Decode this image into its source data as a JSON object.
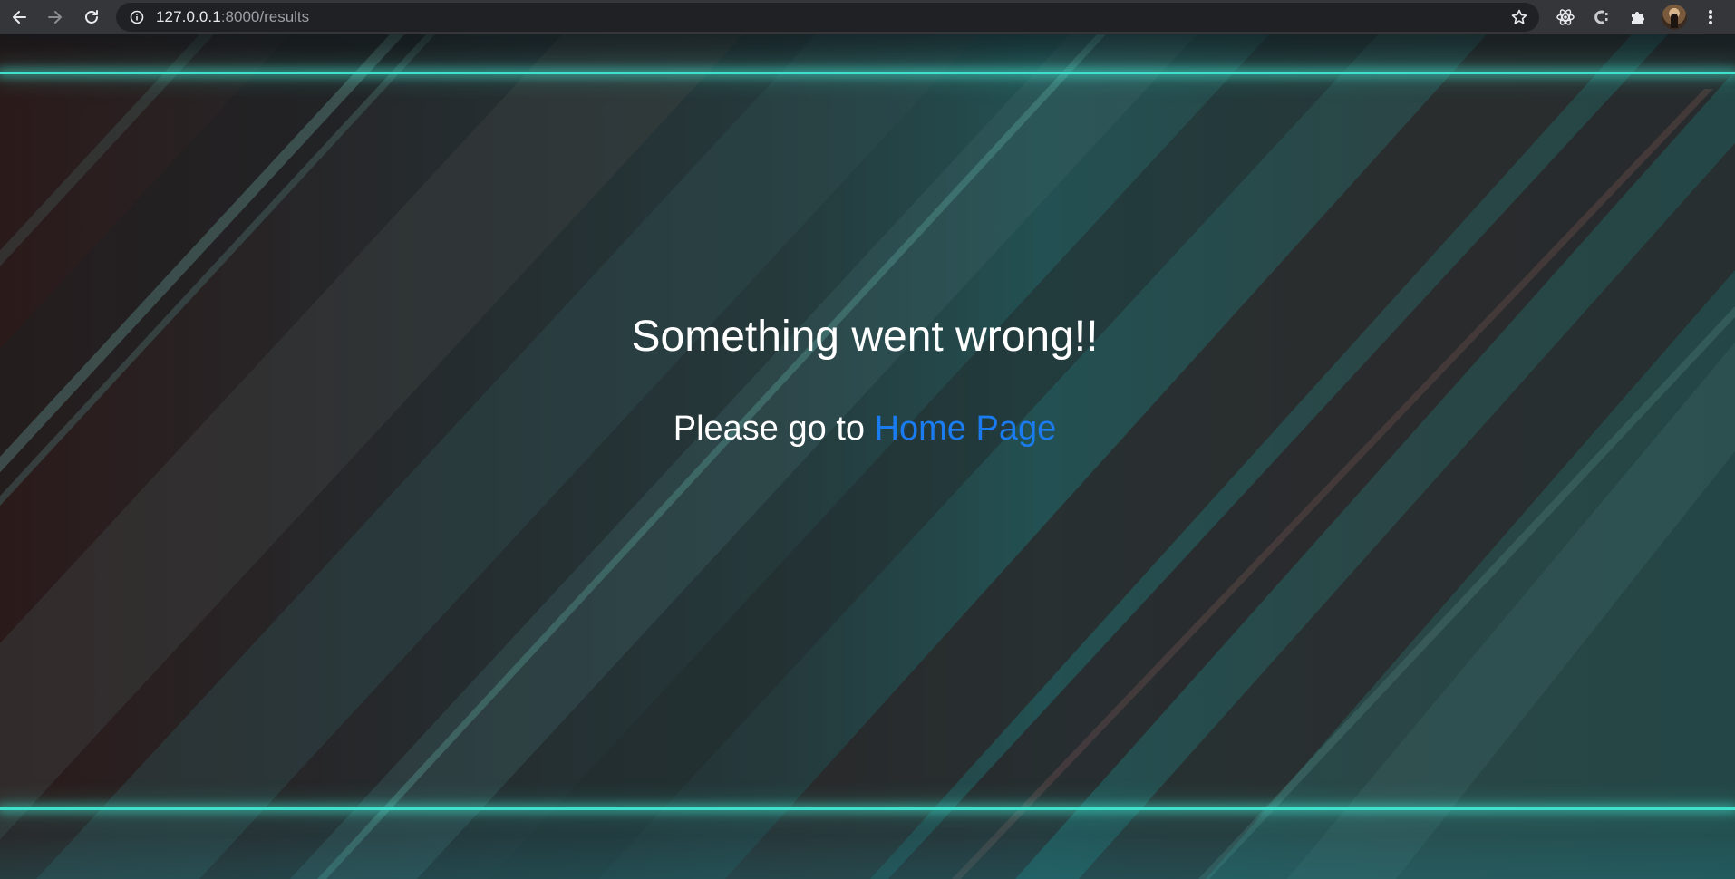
{
  "browser": {
    "url_host": "127.0.0.1",
    "url_path": ":8000/results",
    "icons": [
      "back-arrow-icon",
      "forward-arrow-icon",
      "reload-icon",
      "site-info-icon",
      "bookmark-star-icon",
      "react-devtools-icon",
      "extension-c-icon",
      "extensions-puzzle-icon",
      "profile-avatar",
      "more-menu-icon"
    ]
  },
  "page": {
    "title": "Something went wrong!!",
    "message_prefix": "Please go to ",
    "link_text": "Home Page",
    "colors": {
      "glow_line": "#3fe0cc",
      "link": "#1a7cf0",
      "text": "#ffffff"
    }
  }
}
